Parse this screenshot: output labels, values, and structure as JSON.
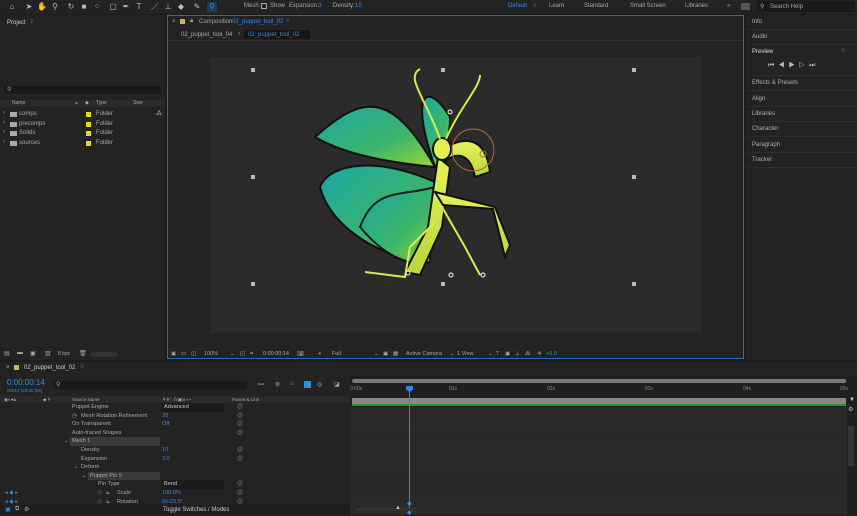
{
  "toolbar": {
    "mesh_label": "Mesh:",
    "show_label": "Show",
    "expansion_label": "Expansion:",
    "expansion_value": "3",
    "density_label": "Density:",
    "density_value": "10"
  },
  "workspaces": [
    "Default",
    "Learn",
    "Standard",
    "Small Screen",
    "Libraries"
  ],
  "search_help": "Search Help",
  "project": {
    "title": "Project",
    "columns": [
      "Name",
      "Type",
      "Size"
    ],
    "items": [
      {
        "name": "comps",
        "type": "Folder"
      },
      {
        "name": "precomps",
        "type": "Folder"
      },
      {
        "name": "Solids",
        "type": "Folder"
      },
      {
        "name": "sources",
        "type": "Folder"
      }
    ],
    "bpc": "8 bpc"
  },
  "composition": {
    "title_prefix": "Composition",
    "comp_name": "02_puppet_tool_02",
    "breadcrumb_prev": "02_puppet_tool_04",
    "breadcrumb_current": "02_puppet_tool_02"
  },
  "viewer_bar": {
    "zoom": "100%",
    "timecode": "0:00:00:14",
    "resolution": "Full",
    "camera": "Active Camera",
    "views": "1 View",
    "exposure": "+0.0"
  },
  "right_panel": {
    "items": [
      "Info",
      "Audio",
      "Preview",
      "Effects & Presets",
      "Align",
      "Libraries",
      "Character",
      "Paragraph",
      "Tracker"
    ]
  },
  "timeline": {
    "tab": "02_puppet_tool_02",
    "timecode": "0:00:00:14",
    "frame_info": "00014 (25.00 fps)",
    "col_source": "Source Name",
    "col_parent": "Parent & Link",
    "toggle": "Toggle Switches / Modes",
    "ruler": [
      "0:00s",
      "01s",
      "02s",
      "03s",
      "04s",
      "05s"
    ],
    "rows": [
      {
        "label": "Puppet Engine",
        "value": "Advanced",
        "indent": 1
      },
      {
        "label": "Mesh Rotation Refinement",
        "value": "20",
        "indent": 1
      },
      {
        "label": "On Transparent",
        "value": "Off",
        "indent": 1
      },
      {
        "label": "Auto-traced Shapes",
        "value": "",
        "indent": 1
      },
      {
        "label": "Mesh 1",
        "value": "",
        "indent": 0
      },
      {
        "label": "Density",
        "value": "10",
        "indent": 2
      },
      {
        "label": "Expansion",
        "value": "3.0",
        "indent": 2
      },
      {
        "label": "Deform",
        "value": "",
        "indent": 2
      },
      {
        "label": "Puppet Pin 5",
        "value": "",
        "indent": 3
      },
      {
        "label": "Pin Type",
        "value": "Bend",
        "indent": 4
      },
      {
        "label": "Scale",
        "value": "100.0%",
        "indent": 5
      },
      {
        "label": "Rotation",
        "value": "0x-23.5°",
        "indent": 5
      }
    ]
  }
}
